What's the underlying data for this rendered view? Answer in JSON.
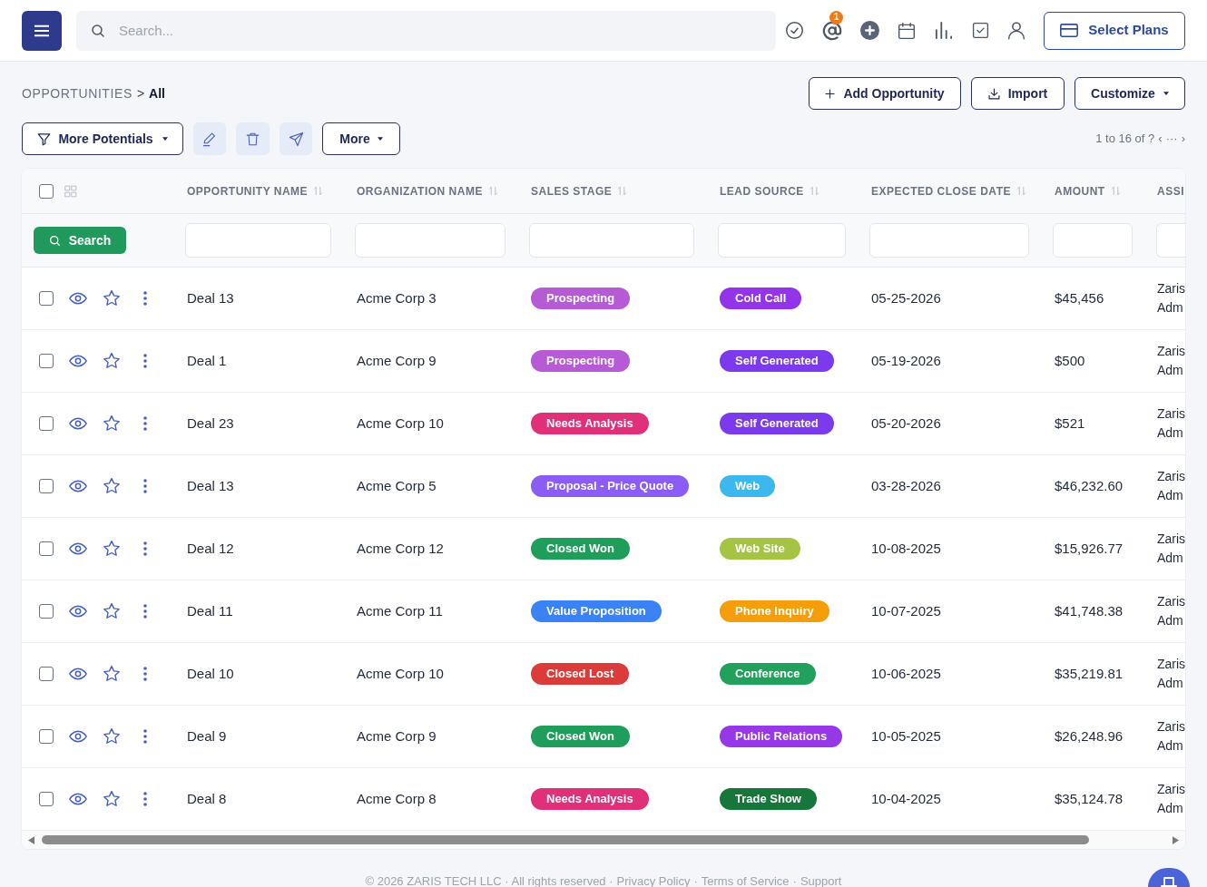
{
  "top_bar": {
    "search": {
      "placeholder": "Search..."
    },
    "notifications": {
      "count": "1"
    },
    "plans_button": "Select Plans"
  },
  "breadcrumb": {
    "section": "OPPORTUNITIES",
    "separator": ">",
    "current": "All"
  },
  "actions": [
    {
      "label": "Add Opportunity",
      "kind": "add"
    },
    {
      "label": "Import",
      "kind": "import"
    },
    {
      "label": "Customize",
      "kind": "dropdown"
    }
  ],
  "toolbar": {
    "filter_button": "More Potentials",
    "more_button": "More"
  },
  "pagination": {
    "range": "1 to 16 of ?",
    "prev": "‹",
    "ellipsis": "···",
    "next": "›"
  },
  "table": {
    "select_all": {
      "checked": false
    },
    "search_button": "Search",
    "columns": [
      {
        "label": "OPPORTUNITY NAME",
        "sortable": true
      },
      {
        "label": "ORGANIZATION NAME",
        "sortable": true
      },
      {
        "label": "SALES STAGE",
        "sortable": true
      },
      {
        "label": "LEAD SOURCE",
        "sortable": true
      },
      {
        "label": "EXPECTED CLOSE DATE",
        "sortable": true
      },
      {
        "label": "AMOUNT",
        "sortable": true
      },
      {
        "label": "ASSI",
        "sortable": false
      }
    ],
    "rows": [
      {
        "checked": false,
        "name": "Deal 13",
        "organization": "Acme Corp 3",
        "sales_stage": {
          "label": "Prospecting",
          "color": "#b75ad6"
        },
        "lead_source": {
          "label": "Cold Call",
          "color": "#9333ea"
        },
        "close_date": "05-25-2026",
        "amount": "$45,456",
        "assigned": "Zaris Adm"
      },
      {
        "checked": false,
        "name": "Deal 1",
        "organization": "Acme Corp 9",
        "sales_stage": {
          "label": "Prospecting",
          "color": "#b75ad6"
        },
        "lead_source": {
          "label": "Self Generated",
          "color": "#7c3aed"
        },
        "close_date": "05-19-2026",
        "amount": "$500",
        "assigned": "Zaris Adm"
      },
      {
        "checked": false,
        "name": "Deal 23",
        "organization": "Acme Corp 10",
        "sales_stage": {
          "label": "Needs Analysis",
          "color": "#e0307a"
        },
        "lead_source": {
          "label": "Self Generated",
          "color": "#7c3aed"
        },
        "close_date": "05-20-2026",
        "amount": "$521",
        "assigned": "Zaris Adm"
      },
      {
        "checked": false,
        "name": "Deal 13",
        "organization": "Acme Corp 5",
        "sales_stage": {
          "label": "Proposal - Price Quote",
          "color": "#8b5cf6"
        },
        "lead_source": {
          "label": "Web",
          "color": "#3bb8ee"
        },
        "close_date": "03-28-2026",
        "amount": "$46,232.60",
        "assigned": "Zaris Adm"
      },
      {
        "checked": false,
        "name": "Deal 12",
        "organization": "Acme Corp 12",
        "sales_stage": {
          "label": "Closed Won",
          "color": "#1f9d5a"
        },
        "lead_source": {
          "label": "Web Site",
          "color": "#a6c444"
        },
        "close_date": "10-08-2025",
        "amount": "$15,926.77",
        "assigned": "Zaris Adm"
      },
      {
        "checked": false,
        "name": "Deal 11",
        "organization": "Acme Corp 11",
        "sales_stage": {
          "label": "Value Proposition",
          "color": "#3b82f6"
        },
        "lead_source": {
          "label": "Phone Inquiry",
          "color": "#f59e0b"
        },
        "close_date": "10-07-2025",
        "amount": "$41,748.38",
        "assigned": "Zaris Adm"
      },
      {
        "checked": false,
        "name": "Deal 10",
        "organization": "Acme Corp 10",
        "sales_stage": {
          "label": "Closed Lost",
          "color": "#dc3b3b"
        },
        "lead_source": {
          "label": "Conference",
          "color": "#21a15b"
        },
        "close_date": "10-06-2025",
        "amount": "$35,219.81",
        "assigned": "Zaris Adm"
      },
      {
        "checked": false,
        "name": "Deal 9",
        "organization": "Acme Corp 9",
        "sales_stage": {
          "label": "Closed Won",
          "color": "#1f9d5a"
        },
        "lead_source": {
          "label": "Public Relations",
          "color": "#9637e8"
        },
        "close_date": "10-05-2025",
        "amount": "$26,248.96",
        "assigned": "Zaris Adm"
      },
      {
        "checked": false,
        "name": "Deal 8",
        "organization": "Acme Corp 8",
        "sales_stage": {
          "label": "Needs Analysis",
          "color": "#e0307a"
        },
        "lead_source": {
          "label": "Trade Show",
          "color": "#17773b"
        },
        "close_date": "10-04-2025",
        "amount": "$35,124.78",
        "assigned": "Zaris Adm"
      }
    ]
  },
  "footer": {
    "copyright": "© 2026 ZARIS TECH LLC · All rights reserved ·",
    "links": [
      {
        "label": "Privacy Policy",
        "separator": "·"
      },
      {
        "label": "Terms of Service",
        "separator": "·"
      },
      {
        "label": "Support"
      }
    ]
  }
}
